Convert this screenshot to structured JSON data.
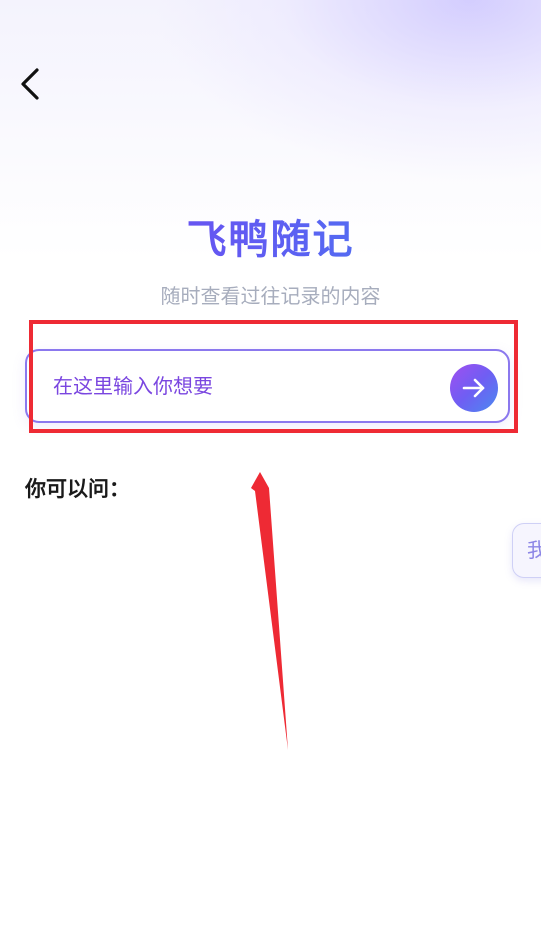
{
  "header": {
    "back_icon": "chevron-left-icon"
  },
  "app": {
    "title": "飞鸭随记",
    "subtitle": "随时查看过往记录的内容",
    "title_gradient": [
      "#7b3ff0",
      "#3e8cf0"
    ]
  },
  "search": {
    "placeholder": "在这里输入你想要",
    "value": "",
    "submit_icon": "arrow-right-icon",
    "border_color": "#8b78ee"
  },
  "suggestions": {
    "label": "你可以问："
  },
  "side_tab": {
    "label": "我"
  },
  "annotation": {
    "color": "#ee2a34"
  }
}
